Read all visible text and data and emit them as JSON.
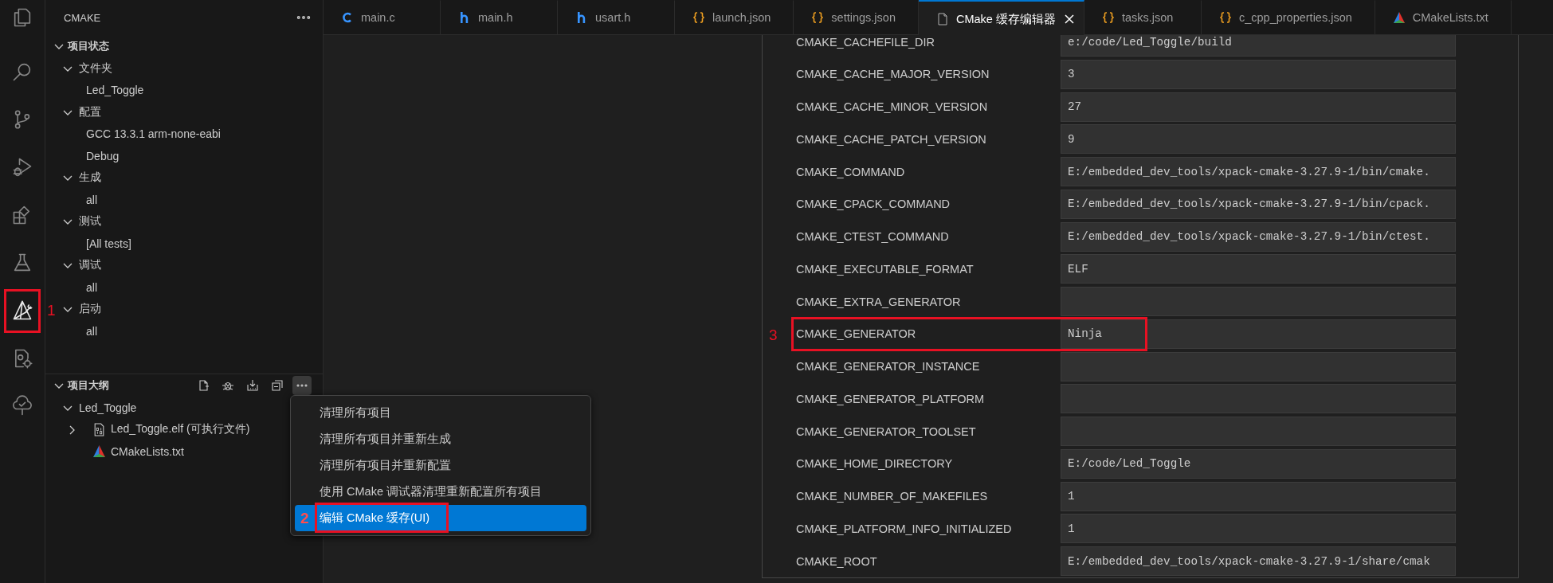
{
  "activity_bar": {
    "items": [
      {
        "kind": "files",
        "selected": false
      },
      {
        "kind": "search",
        "selected": false
      },
      {
        "kind": "source-control",
        "selected": false
      },
      {
        "kind": "run-debug",
        "selected": false
      },
      {
        "kind": "extensions",
        "selected": false
      },
      {
        "kind": "testing",
        "selected": false
      },
      {
        "kind": "cmake",
        "selected": true,
        "annotation": "1"
      },
      {
        "kind": "remote-config",
        "selected": false
      },
      {
        "kind": "tree-check",
        "selected": false
      }
    ]
  },
  "sidebar": {
    "title": "CMAKE",
    "sections": [
      {
        "title": "项目状态",
        "expanded": true,
        "children": [
          {
            "label": "文件夹",
            "expanded": true,
            "children": [
              {
                "label": "Led_Toggle"
              }
            ]
          },
          {
            "label": "配置",
            "expanded": true,
            "children": [
              {
                "label": "GCC 13.3.1 arm-none-eabi"
              },
              {
                "label": "Debug"
              }
            ]
          },
          {
            "label": "生成",
            "expanded": true,
            "children": [
              {
                "label": "all"
              }
            ]
          },
          {
            "label": "测试",
            "expanded": true,
            "children": [
              {
                "label": "[All tests]"
              }
            ]
          },
          {
            "label": "调试",
            "expanded": true,
            "children": [
              {
                "label": "all"
              }
            ]
          },
          {
            "label": "启动",
            "expanded": true,
            "children": [
              {
                "label": "all"
              }
            ]
          }
        ]
      },
      {
        "title": "项目大纲",
        "expanded": true,
        "toolbar": [
          {
            "kind": "new-file",
            "selected": false
          },
          {
            "kind": "debug",
            "selected": false
          },
          {
            "kind": "install",
            "selected": false
          },
          {
            "kind": "collapse-all",
            "selected": false
          },
          {
            "kind": "more",
            "selected": true
          }
        ],
        "children": [
          {
            "label": "Led_Toggle",
            "expanded": true,
            "children": [
              {
                "label": "Led_Toggle.elf (可执行文件)",
                "kind": "executable",
                "expanded": false
              },
              {
                "label": "CMakeLists.txt",
                "kind": "cmake-file"
              }
            ]
          }
        ]
      }
    ]
  },
  "context_menu": {
    "items": [
      {
        "label": "清理所有项目",
        "selected": false
      },
      {
        "label": "清理所有项目并重新生成",
        "selected": false
      },
      {
        "label": "清理所有项目并重新配置",
        "selected": false
      },
      {
        "label": "使用 CMake 调试器清理重新配置所有项目",
        "selected": false
      },
      {
        "label": "编辑 CMake 缓存(UI)",
        "selected": true,
        "annotation": "2"
      }
    ]
  },
  "tabs": [
    {
      "label": "main.c",
      "kind": "c",
      "selected": false
    },
    {
      "label": "main.h",
      "kind": "h",
      "selected": false
    },
    {
      "label": "usart.h",
      "kind": "h",
      "selected": false
    },
    {
      "label": "launch.json",
      "kind": "json",
      "selected": false
    },
    {
      "label": "settings.json",
      "kind": "json",
      "selected": false
    },
    {
      "label": "CMake 缓存编辑器",
      "kind": "preview",
      "selected": true
    },
    {
      "label": "tasks.json",
      "kind": "json",
      "selected": false
    },
    {
      "label": "c_cpp_properties.json",
      "kind": "json",
      "selected": false
    },
    {
      "label": "CMakeLists.txt",
      "kind": "cmake",
      "selected": false
    }
  ],
  "cache_editor": {
    "rows": [
      {
        "key": "CMAKE_CACHEFILE_DIR",
        "value": "e:/code/Led_Toggle/build"
      },
      {
        "key": "CMAKE_CACHE_MAJOR_VERSION",
        "value": "3"
      },
      {
        "key": "CMAKE_CACHE_MINOR_VERSION",
        "value": "27"
      },
      {
        "key": "CMAKE_CACHE_PATCH_VERSION",
        "value": "9"
      },
      {
        "key": "CMAKE_COMMAND",
        "value": "E:/embedded_dev_tools/xpack-cmake-3.27.9-1/bin/cmake."
      },
      {
        "key": "CMAKE_CPACK_COMMAND",
        "value": "E:/embedded_dev_tools/xpack-cmake-3.27.9-1/bin/cpack."
      },
      {
        "key": "CMAKE_CTEST_COMMAND",
        "value": "E:/embedded_dev_tools/xpack-cmake-3.27.9-1/bin/ctest."
      },
      {
        "key": "CMAKE_EXECUTABLE_FORMAT",
        "value": "ELF"
      },
      {
        "key": "CMAKE_EXTRA_GENERATOR"
      },
      {
        "key": "CMAKE_GENERATOR",
        "value": "Ninja",
        "annotation": "3"
      },
      {
        "key": "CMAKE_GENERATOR_INSTANCE"
      },
      {
        "key": "CMAKE_GENERATOR_PLATFORM"
      },
      {
        "key": "CMAKE_GENERATOR_TOOLSET"
      },
      {
        "key": "CMAKE_HOME_DIRECTORY",
        "value": "E:/code/Led_Toggle"
      },
      {
        "key": "CMAKE_NUMBER_OF_MAKEFILES",
        "value": "1"
      },
      {
        "key": "CMAKE_PLATFORM_INFO_INITIALIZED",
        "value": "1"
      },
      {
        "key": "CMAKE_ROOT",
        "value": "E:/embedded_dev_tools/xpack-cmake-3.27.9-1/share/cmak"
      }
    ]
  }
}
